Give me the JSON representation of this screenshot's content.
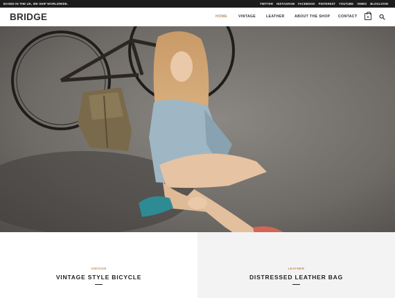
{
  "topbar": {
    "tagline": "BASED IN THE UK, WE SHIP WORLDWIDE.",
    "social": [
      "TWITTER",
      "INSTAGRAM",
      "FACEBOOK",
      "PINTEREST",
      "YOUTUBE",
      "VIMEO",
      "BLOGLOVIN"
    ]
  },
  "header": {
    "logo": "BRIDGE",
    "nav": [
      "HOME",
      "VINTAGE",
      "LEATHER",
      "ABOUT THE SHOP",
      "CONTACT"
    ],
    "active_nav": "HOME",
    "cart_count": "0",
    "icons": [
      "cart-icon",
      "search-icon"
    ]
  },
  "hero": {
    "slides": 4,
    "active_slide": 4
  },
  "products": [
    {
      "category": "VINTAGE",
      "title": "VINTAGE STYLE BICYCLE"
    },
    {
      "category": "LEATHER",
      "title": "DISTRESSED LEATHER BAG"
    }
  ],
  "colors": {
    "accent": "#b88b59",
    "topbar_bg": "#1c1c1c",
    "text_dark": "#303030",
    "panel_gray": "#f3f3f3"
  }
}
